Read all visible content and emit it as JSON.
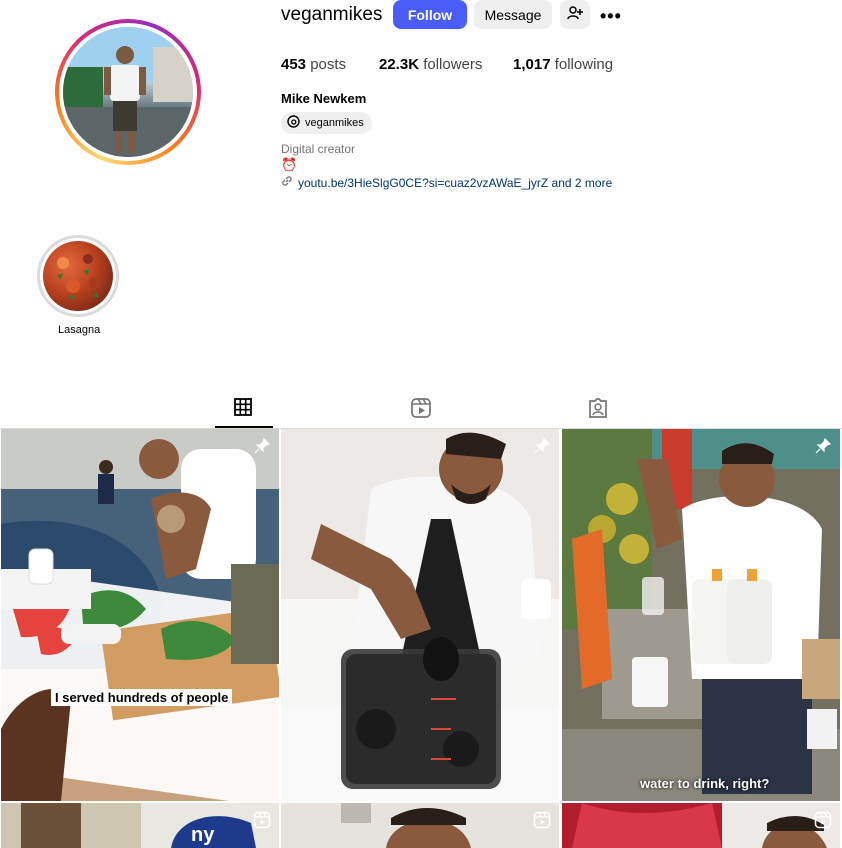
{
  "profile": {
    "username": "veganmikes",
    "follow_label": "Follow",
    "message_label": "Message",
    "posts_count": "453",
    "posts_label": "posts",
    "followers_count": "22.3K",
    "followers_label": "followers",
    "following_count": "1,017",
    "following_label": "following",
    "full_name": "Mike Newkem",
    "threads_handle": "veganmikes",
    "category": "Digital creator",
    "bio_emoji": "⏰",
    "link_text": "youtu.be/3HieSlgG0CE?si=cuaz2vzAWaE_jyrZ and 2 more"
  },
  "highlights": [
    {
      "label": "Lasagna"
    }
  ],
  "tabs": [
    {
      "name": "posts-tab",
      "icon": "grid-icon",
      "active": true
    },
    {
      "name": "reels-tab",
      "icon": "reels-icon",
      "active": false
    },
    {
      "name": "tagged-tab",
      "icon": "tagged-icon",
      "active": false
    }
  ],
  "posts": [
    {
      "caption": "I served hundreds of people",
      "badge": "pin-icon"
    },
    {
      "caption": "",
      "badge": "pin-icon"
    },
    {
      "caption": "water to drink, right?",
      "badge": "pin-icon"
    },
    {
      "caption": "",
      "badge": "reel-icon"
    },
    {
      "caption": "",
      "badge": "reel-icon"
    },
    {
      "caption": "",
      "badge": "reel-icon"
    }
  ],
  "colors": {
    "follow_button": "#4a5df9",
    "secondary_button": "#efefef",
    "link": "#00376b"
  }
}
